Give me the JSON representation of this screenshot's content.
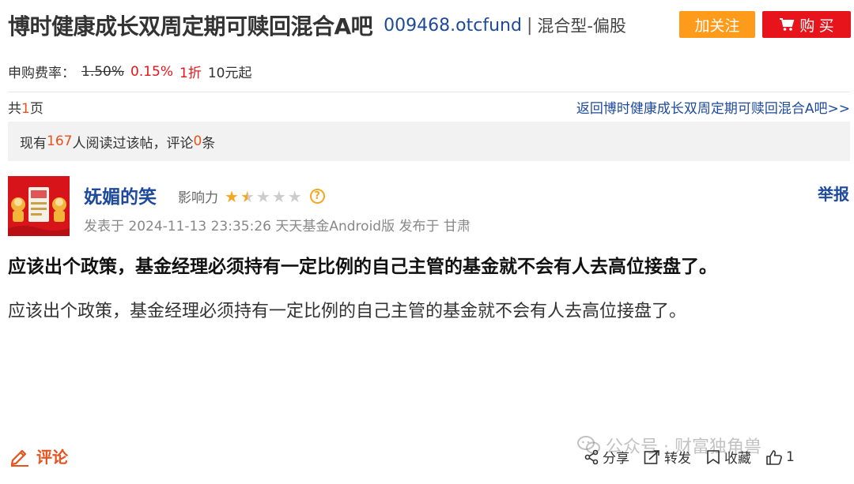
{
  "header": {
    "fund_name": "博时健康成长双周定期可赎回混合A吧",
    "fund_code": "009468.otcfund",
    "separator": "|",
    "fund_type": "混合型-偏股",
    "follow_label": "加关注",
    "buy_label": "购 买"
  },
  "fee": {
    "label": "申购费率：",
    "original": "1.50%",
    "current": "0.15%",
    "discount": "1折",
    "minimum": "10元起"
  },
  "pager": {
    "prefix": "共",
    "count": "1",
    "suffix": "页",
    "back_link": "返回博时健康成长双周定期可赎回混合A吧>>"
  },
  "read_stats": {
    "prefix": "现有",
    "readers": "167",
    "middle": "人阅读过该帖，评论",
    "comments": "0",
    "suffix": "条"
  },
  "post": {
    "author": "妩媚的笑",
    "influence_label": "影响力",
    "influence_stars": 1.5,
    "influence_max": 5,
    "help_icon": "?",
    "report_label": "举报",
    "meta": "发表于 2024-11-13 23:35:26 天天基金Android版 发布于 甘肃",
    "title": "应该出个政策，基金经理必须持有一定比例的自己主管的基金就不会有人去高位接盘了。",
    "body": "应该出个政策，基金经理必须持有一定比例的自己主管的基金就不会有人去高位接盘了。"
  },
  "footer": {
    "comment_label": "评论",
    "share_label": "分享",
    "forward_label": "转发",
    "favorite_label": "收藏",
    "like_count": "1"
  },
  "watermark": {
    "text": "公众号 · 财富独角兽"
  },
  "icons": {
    "cart": "cart-icon",
    "pencil": "pencil-icon",
    "share": "share-icon",
    "forward": "forward-icon",
    "favorite": "favorite-icon",
    "like": "like-icon",
    "wechat": "wechat-icon"
  },
  "colors": {
    "link_blue": "#1d4a9c",
    "accent_orange": "#ff9b1a",
    "buy_red": "#e8141c",
    "highlight_orange": "#e8521c"
  }
}
